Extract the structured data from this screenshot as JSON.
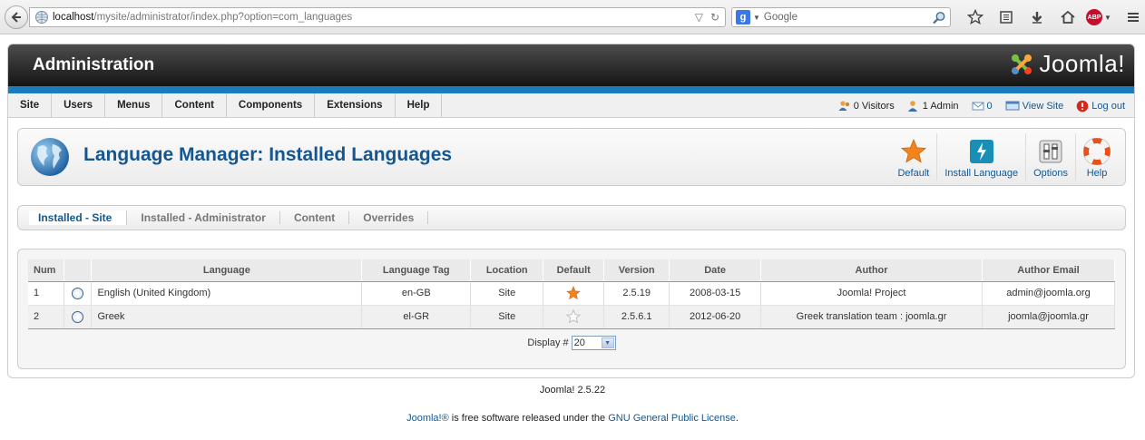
{
  "browser": {
    "url_host": "localhost",
    "url_path": "/mysite/administrator/index.php?option=com_languages",
    "search_placeholder": "Google"
  },
  "header": {
    "title": "Administration",
    "logo_text": "Joomla!"
  },
  "menu": {
    "items": [
      "Site",
      "Users",
      "Menus",
      "Content",
      "Components",
      "Extensions",
      "Help"
    ]
  },
  "status": {
    "visitors": "0 Visitors",
    "admins": "1 Admin",
    "messages": "0",
    "view_site": "View Site",
    "logout": "Log out"
  },
  "page": {
    "title": "Language Manager: Installed Languages"
  },
  "toolbar": {
    "default_label": "Default",
    "install_label": "Install Language",
    "options_label": "Options",
    "help_label": "Help"
  },
  "subtabs": [
    "Installed - Site",
    "Installed - Administrator",
    "Content",
    "Overrides"
  ],
  "table": {
    "headers": [
      "Num",
      "",
      "Language",
      "Language Tag",
      "Location",
      "Default",
      "Version",
      "Date",
      "Author",
      "Author Email"
    ],
    "rows": [
      {
        "num": "1",
        "language": "English (United Kingdom)",
        "tag": "en-GB",
        "location": "Site",
        "default": true,
        "version": "2.5.19",
        "date": "2008-03-15",
        "author": "Joomla! Project",
        "email": "admin@joomla.org"
      },
      {
        "num": "2",
        "language": "Greek",
        "tag": "el-GR",
        "location": "Site",
        "default": false,
        "version": "2.5.6.1",
        "date": "2012-06-20",
        "author": "Greek translation team : joomla.gr",
        "email": "joomla@joomla.gr"
      }
    ],
    "display_label": "Display #",
    "display_value": "20"
  },
  "footer": {
    "version": "Joomla! 2.5.22",
    "license_link": "Joomla!®",
    "license_text": " is free software released under the ",
    "license_gpl": "GNU General Public License",
    "license_end": "."
  },
  "colors": {
    "accent": "#15568e",
    "band": "#1b7bbd",
    "star": "#f2841b"
  }
}
